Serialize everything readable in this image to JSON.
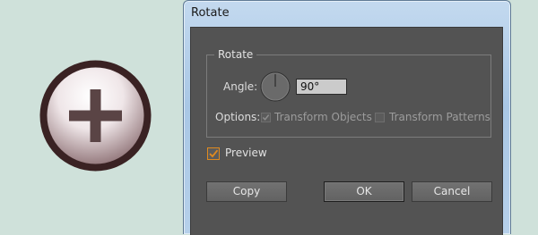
{
  "window": {
    "title": "Rotate"
  },
  "dialog": {
    "group_label": "Rotate",
    "angle": {
      "label": "Angle:",
      "value": "90°"
    },
    "options": {
      "label": "Options:",
      "transform_objects": {
        "label": "Transform Objects",
        "checked": true,
        "enabled": false
      },
      "transform_patterns": {
        "label": "Transform Patterns",
        "checked": false,
        "enabled": false
      }
    },
    "preview": {
      "label": "Preview",
      "checked": true
    },
    "buttons": {
      "copy": "Copy",
      "ok": "OK",
      "cancel": "Cancel"
    }
  },
  "colors": {
    "background": "#cfe1da",
    "dialog_bg": "#535353",
    "preview_check": "#e08a1f",
    "icon_ring": "#3a2223",
    "icon_plus": "#5a4445"
  },
  "icons": {
    "artboard": "plus-circle-icon",
    "dial": "angle-dial-icon",
    "checkmark": "check-icon"
  }
}
